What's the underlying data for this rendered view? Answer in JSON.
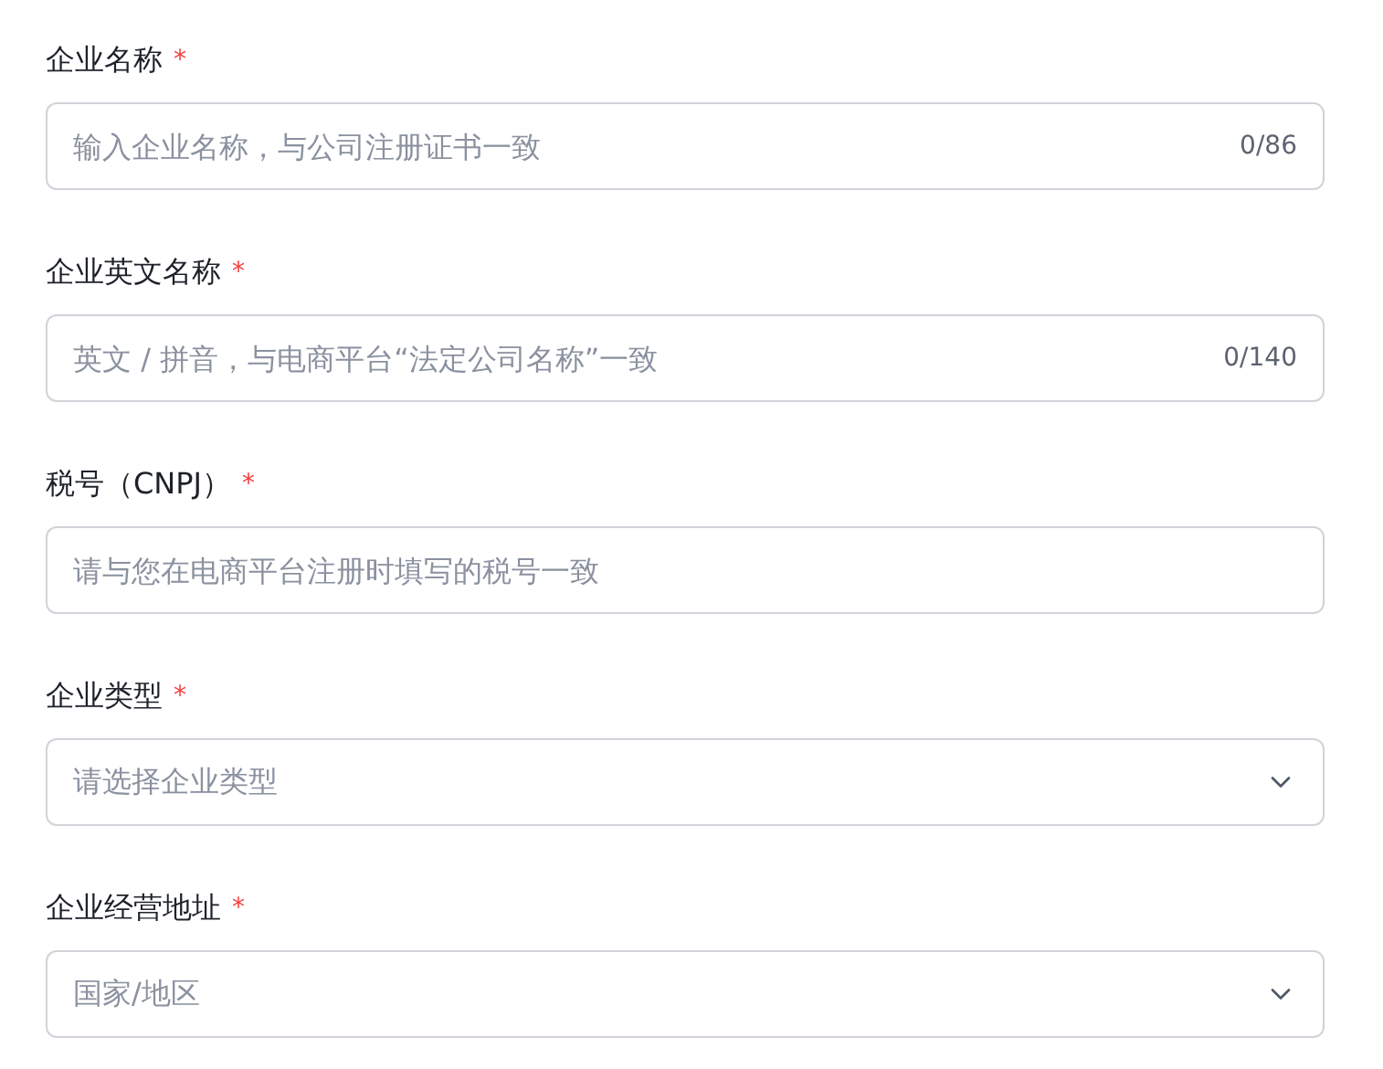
{
  "fields": [
    {
      "kind": "text",
      "label": "企业名称",
      "required_mark": "*",
      "placeholder": "输入企业名称，与公司注册证书一致",
      "counter": "0/86"
    },
    {
      "kind": "text",
      "label": "企业英文名称",
      "required_mark": "*",
      "placeholder": "英文 / 拼音，与电商平台“法定公司名称”一致",
      "counter": "0/140"
    },
    {
      "kind": "text",
      "label": "税号（CNPJ）",
      "required_mark": "*",
      "placeholder": "请与您在电商平台注册时填写的税号一致"
    },
    {
      "kind": "select",
      "label": "企业类型",
      "required_mark": "*",
      "placeholder": "请选择企业类型"
    },
    {
      "kind": "select",
      "label": "企业经营地址",
      "required_mark": "*",
      "placeholder": "国家/地区"
    }
  ]
}
